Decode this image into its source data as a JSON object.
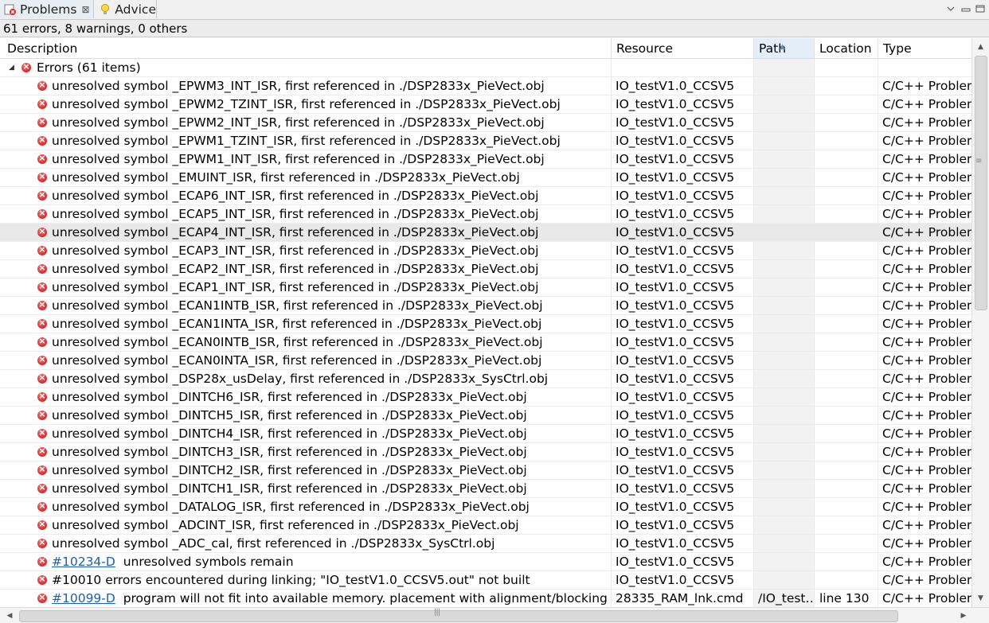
{
  "tabs": [
    {
      "label": "Problems",
      "icon": "problems-view-icon",
      "active": true
    },
    {
      "label": "Advice",
      "icon": "lightbulb-icon",
      "active": false
    }
  ],
  "summary": "61 errors, 8 warnings, 0 others",
  "columns": [
    "Description",
    "Resource",
    "Path",
    "Location",
    "Type"
  ],
  "sorted_column": "Path",
  "group": {
    "label": "Errors (61 items)",
    "expanded": true
  },
  "rows": [
    {
      "link": "",
      "text": "unresolved symbol _EPWM3_INT_ISR, first referenced in ./DSP2833x_PieVect.obj",
      "resource": "IO_testV1.0_CCSV5",
      "path": "",
      "location": "",
      "type": "C/C++ Problem"
    },
    {
      "link": "",
      "text": "unresolved symbol _EPWM2_TZINT_ISR, first referenced in ./DSP2833x_PieVect.obj",
      "resource": "IO_testV1.0_CCSV5",
      "path": "",
      "location": "",
      "type": "C/C++ Problem"
    },
    {
      "link": "",
      "text": "unresolved symbol _EPWM2_INT_ISR, first referenced in ./DSP2833x_PieVect.obj",
      "resource": "IO_testV1.0_CCSV5",
      "path": "",
      "location": "",
      "type": "C/C++ Problem"
    },
    {
      "link": "",
      "text": "unresolved symbol _EPWM1_TZINT_ISR, first referenced in ./DSP2833x_PieVect.obj",
      "resource": "IO_testV1.0_CCSV5",
      "path": "",
      "location": "",
      "type": "C/C++ Problem"
    },
    {
      "link": "",
      "text": "unresolved symbol _EPWM1_INT_ISR, first referenced in ./DSP2833x_PieVect.obj",
      "resource": "IO_testV1.0_CCSV5",
      "path": "",
      "location": "",
      "type": "C/C++ Problem"
    },
    {
      "link": "",
      "text": "unresolved symbol _EMUINT_ISR, first referenced in ./DSP2833x_PieVect.obj",
      "resource": "IO_testV1.0_CCSV5",
      "path": "",
      "location": "",
      "type": "C/C++ Problem"
    },
    {
      "link": "",
      "text": "unresolved symbol _ECAP6_INT_ISR, first referenced in ./DSP2833x_PieVect.obj",
      "resource": "IO_testV1.0_CCSV5",
      "path": "",
      "location": "",
      "type": "C/C++ Problem"
    },
    {
      "link": "",
      "text": "unresolved symbol _ECAP5_INT_ISR, first referenced in ./DSP2833x_PieVect.obj",
      "resource": "IO_testV1.0_CCSV5",
      "path": "",
      "location": "",
      "type": "C/C++ Problem"
    },
    {
      "link": "",
      "text": "unresolved symbol _ECAP4_INT_ISR, first referenced in ./DSP2833x_PieVect.obj",
      "resource": "IO_testV1.0_CCSV5",
      "path": "",
      "location": "",
      "type": "C/C++ Problem",
      "selected": true
    },
    {
      "link": "",
      "text": "unresolved symbol _ECAP3_INT_ISR, first referenced in ./DSP2833x_PieVect.obj",
      "resource": "IO_testV1.0_CCSV5",
      "path": "",
      "location": "",
      "type": "C/C++ Problem"
    },
    {
      "link": "",
      "text": "unresolved symbol _ECAP2_INT_ISR, first referenced in ./DSP2833x_PieVect.obj",
      "resource": "IO_testV1.0_CCSV5",
      "path": "",
      "location": "",
      "type": "C/C++ Problem"
    },
    {
      "link": "",
      "text": "unresolved symbol _ECAP1_INT_ISR, first referenced in ./DSP2833x_PieVect.obj",
      "resource": "IO_testV1.0_CCSV5",
      "path": "",
      "location": "",
      "type": "C/C++ Problem"
    },
    {
      "link": "",
      "text": "unresolved symbol _ECAN1INTB_ISR, first referenced in ./DSP2833x_PieVect.obj",
      "resource": "IO_testV1.0_CCSV5",
      "path": "",
      "location": "",
      "type": "C/C++ Problem"
    },
    {
      "link": "",
      "text": "unresolved symbol _ECAN1INTA_ISR, first referenced in ./DSP2833x_PieVect.obj",
      "resource": "IO_testV1.0_CCSV5",
      "path": "",
      "location": "",
      "type": "C/C++ Problem"
    },
    {
      "link": "",
      "text": "unresolved symbol _ECAN0INTB_ISR, first referenced in ./DSP2833x_PieVect.obj",
      "resource": "IO_testV1.0_CCSV5",
      "path": "",
      "location": "",
      "type": "C/C++ Problem"
    },
    {
      "link": "",
      "text": "unresolved symbol _ECAN0INTA_ISR, first referenced in ./DSP2833x_PieVect.obj",
      "resource": "IO_testV1.0_CCSV5",
      "path": "",
      "location": "",
      "type": "C/C++ Problem"
    },
    {
      "link": "",
      "text": "unresolved symbol _DSP28x_usDelay, first referenced in ./DSP2833x_SysCtrl.obj",
      "resource": "IO_testV1.0_CCSV5",
      "path": "",
      "location": "",
      "type": "C/C++ Problem"
    },
    {
      "link": "",
      "text": "unresolved symbol _DINTCH6_ISR, first referenced in ./DSP2833x_PieVect.obj",
      "resource": "IO_testV1.0_CCSV5",
      "path": "",
      "location": "",
      "type": "C/C++ Problem"
    },
    {
      "link": "",
      "text": "unresolved symbol _DINTCH5_ISR, first referenced in ./DSP2833x_PieVect.obj",
      "resource": "IO_testV1.0_CCSV5",
      "path": "",
      "location": "",
      "type": "C/C++ Problem"
    },
    {
      "link": "",
      "text": "unresolved symbol _DINTCH4_ISR, first referenced in ./DSP2833x_PieVect.obj",
      "resource": "IO_testV1.0_CCSV5",
      "path": "",
      "location": "",
      "type": "C/C++ Problem"
    },
    {
      "link": "",
      "text": "unresolved symbol _DINTCH3_ISR, first referenced in ./DSP2833x_PieVect.obj",
      "resource": "IO_testV1.0_CCSV5",
      "path": "",
      "location": "",
      "type": "C/C++ Problem"
    },
    {
      "link": "",
      "text": "unresolved symbol _DINTCH2_ISR, first referenced in ./DSP2833x_PieVect.obj",
      "resource": "IO_testV1.0_CCSV5",
      "path": "",
      "location": "",
      "type": "C/C++ Problem"
    },
    {
      "link": "",
      "text": "unresolved symbol _DINTCH1_ISR, first referenced in ./DSP2833x_PieVect.obj",
      "resource": "IO_testV1.0_CCSV5",
      "path": "",
      "location": "",
      "type": "C/C++ Problem"
    },
    {
      "link": "",
      "text": "unresolved symbol _DATALOG_ISR, first referenced in ./DSP2833x_PieVect.obj",
      "resource": "IO_testV1.0_CCSV5",
      "path": "",
      "location": "",
      "type": "C/C++ Problem"
    },
    {
      "link": "",
      "text": "unresolved symbol _ADCINT_ISR, first referenced in ./DSP2833x_PieVect.obj",
      "resource": "IO_testV1.0_CCSV5",
      "path": "",
      "location": "",
      "type": "C/C++ Problem"
    },
    {
      "link": "",
      "text": "unresolved symbol _ADC_cal, first referenced in ./DSP2833x_SysCtrl.obj",
      "resource": "IO_testV1.0_CCSV5",
      "path": "",
      "location": "",
      "type": "C/C++ Problem"
    },
    {
      "link": "#10234-D",
      "text": "unresolved symbols remain",
      "resource": "IO_testV1.0_CCSV5",
      "path": "",
      "location": "",
      "type": "C/C++ Problem"
    },
    {
      "link": "",
      "text": "#10010 errors encountered during linking; \"IO_testV1.0_CCSV5.out\" not built",
      "resource": "IO_testV1.0_CCSV5",
      "path": "",
      "location": "",
      "type": "C/C++ Problem"
    },
    {
      "link": "#10099-D",
      "text": "program will not fit into available memory.  placement with alignment/blocking fails fo",
      "resource": "28335_RAM_lnk.cmd",
      "path": "/IO_test…",
      "location": "line 130",
      "type": "C/C++ Problem"
    }
  ]
}
